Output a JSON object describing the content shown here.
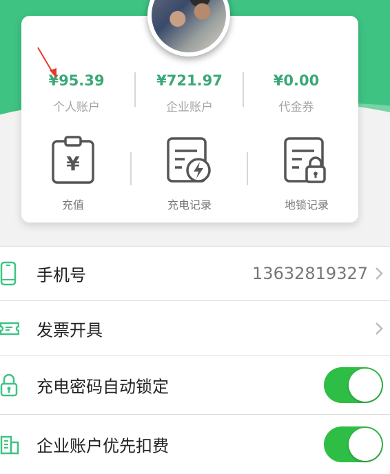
{
  "colors": {
    "primary_green": "#3ec383",
    "amount_green": "#3aa877",
    "toggle_on": "#2fbe45"
  },
  "stats": [
    {
      "amount": "¥95.39",
      "label": "个人账户"
    },
    {
      "amount": "¥721.97",
      "label": "企业账户"
    },
    {
      "amount": "¥0.00",
      "label": "代金券"
    }
  ],
  "actions": [
    {
      "label": "充值",
      "icon": "recharge-clipboard-yen-icon"
    },
    {
      "label": "充电记录",
      "icon": "charging-record-icon"
    },
    {
      "label": "地锁记录",
      "icon": "lock-record-icon"
    }
  ],
  "settings": [
    {
      "label": "手机号",
      "value": "13632819327",
      "icon": "phone-icon",
      "control": "chevron"
    },
    {
      "label": "发票开具",
      "icon": "ticket-icon",
      "control": "chevron"
    },
    {
      "label": "充电密码自动锁定",
      "icon": "lock-icon",
      "control": "toggle",
      "toggle_on": true
    },
    {
      "label": "企业账户优先扣费",
      "icon": "building-icon",
      "control": "toggle",
      "toggle_on": true
    }
  ]
}
